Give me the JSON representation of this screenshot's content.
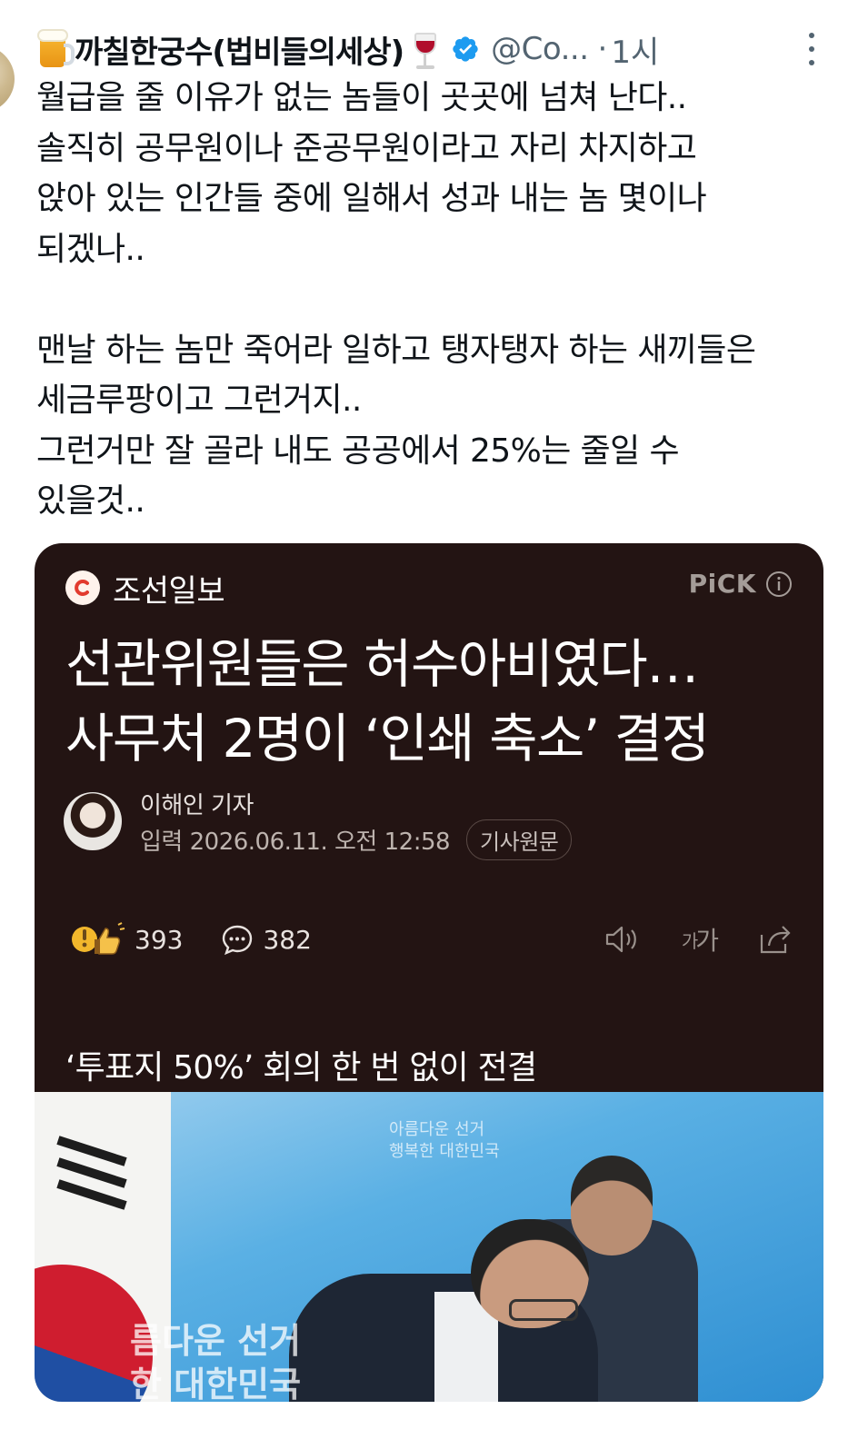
{
  "author": {
    "name": "까칠한궁수(법비들의세상)",
    "handle": "@Co...",
    "time": "1시",
    "separator": "·",
    "name_prefix_emoji": "beer-mug-icon",
    "name_suffix_emoji": "wine-glass-icon",
    "verified": true
  },
  "tweet_lines": [
    "월급을 줄 이유가 없는 놈들이 곳곳에 넘쳐 난다..",
    "솔직히 공무원이나 준공무원이라고 자리 차지하고",
    "앉아 있는 인간들 중에 일해서 성과 내는 놈 몇이나",
    "되겠나..",
    "",
    "맨날 하는 놈만 죽어라 일하고 탱자탱자 하는 새끼들은",
    "세금루팡이고 그런거지..",
    "그런거만 잘 골라 내도 공공에서 25%는 줄일 수",
    "있을것.."
  ],
  "article": {
    "publisher": "조선일보",
    "pick_label": "PiCK",
    "headline_lines": [
      "선관위원들은 허수아비였다…",
      "사무처 2명이 ‘인쇄 축소’ 결정"
    ],
    "reporter": "이해인 기자",
    "dateline": "입력 2026.06.11. 오전 12:58",
    "original_button": "기사원문",
    "reaction_count": "393",
    "comment_count": "382",
    "font_size_label_small": "가",
    "font_size_label_large": "가",
    "subheadline": "‘투표지 50%’ 회의 한 번 없이 전결",
    "photo": {
      "backdrop_text_lines": [
        "름다운 선거",
        "한 대한민국"
      ],
      "logo_text_lines": [
        "아름다운 선거",
        "행복한 대한민국"
      ]
    }
  },
  "colors": {
    "text_primary": "#0f1419",
    "text_secondary": "#536471",
    "verified_blue": "#1d9bf0",
    "card_background": "#231413",
    "pick_gray": "#a49c98"
  }
}
